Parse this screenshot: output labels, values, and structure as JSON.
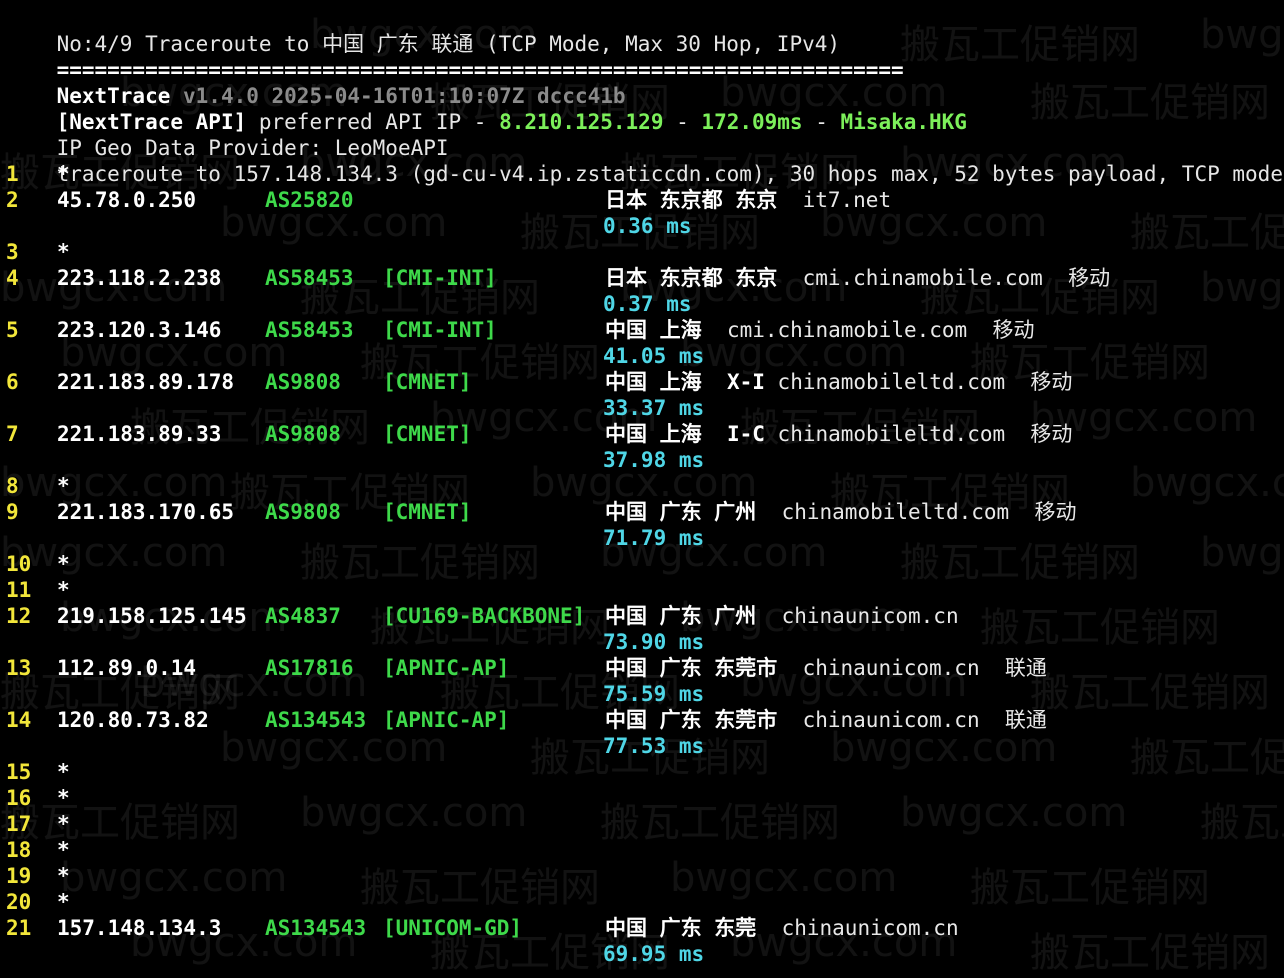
{
  "header": {
    "title_line": "No:4/9 Traceroute to 中国 广东 联通 (TCP Mode, Max 30 Hop, IPv4)",
    "separator": "===================================================================",
    "app_name": "NextTrace",
    "version_info": " v1.4.0 2025-04-16T01:10:07Z dccc41b",
    "api_label": "[NextTrace API]",
    "api_text": " preferred API IP - ",
    "api_ip": "8.210.125.129",
    "api_dash1": " - ",
    "api_latency": "172.09ms",
    "api_dash2": " - ",
    "api_node": "Misaka.HKG",
    "geo_provider": "IP Geo Data Provider: LeoMoeAPI",
    "traceroute_line": "traceroute to 157.148.134.3 (gd-cu-v4.ip.zstaticcdn.com), 30 hops max, 52 bytes payload, TCP mode"
  },
  "hops": [
    {
      "num": "1",
      "star": "*"
    },
    {
      "num": "2",
      "ip": "45.78.0.250",
      "asn": "AS25820",
      "tag": "",
      "geo": "日本 东京都 东京",
      "code": "",
      "host": "it7.net",
      "isp": "",
      "rtt": "0.36 ms"
    },
    {
      "num": "3",
      "star": "*"
    },
    {
      "num": "4",
      "ip": "223.118.2.238",
      "asn": "AS58453",
      "tag": "[CMI-INT]",
      "geo": "日本 东京都 东京",
      "code": "",
      "host": "cmi.chinamobile.com",
      "isp": "移动",
      "rtt": "0.37 ms"
    },
    {
      "num": "5",
      "ip": "223.120.3.146",
      "asn": "AS58453",
      "tag": "[CMI-INT]",
      "geo": "中国 上海",
      "code": "",
      "host": "cmi.chinamobile.com",
      "isp": "移动",
      "rtt": "41.05 ms"
    },
    {
      "num": "6",
      "ip": "221.183.89.178",
      "asn": "AS9808",
      "tag": "[CMNET]",
      "geo": "中国 上海",
      "code": "X-I",
      "host": "chinamobileltd.com",
      "isp": "移动",
      "rtt": "33.37 ms"
    },
    {
      "num": "7",
      "ip": "221.183.89.33",
      "asn": "AS9808",
      "tag": "[CMNET]",
      "geo": "中国 上海",
      "code": "I-C",
      "host": "chinamobileltd.com",
      "isp": "移动",
      "rtt": "37.98 ms"
    },
    {
      "num": "8",
      "star": "*"
    },
    {
      "num": "9",
      "ip": "221.183.170.65",
      "asn": "AS9808",
      "tag": "[CMNET]",
      "geo": "中国 广东 广州",
      "code": "",
      "host": "chinamobileltd.com",
      "isp": "移动",
      "rtt": "71.79 ms"
    },
    {
      "num": "10",
      "star": "*"
    },
    {
      "num": "11",
      "star": "*"
    },
    {
      "num": "12",
      "ip": "219.158.125.145",
      "asn": "AS4837",
      "tag": "[CU169-BACKBONE]",
      "geo": "中国 广东 广州",
      "code": "",
      "host": "chinaunicom.cn",
      "isp": "",
      "rtt": "73.90 ms"
    },
    {
      "num": "13",
      "ip": "112.89.0.14",
      "asn": "AS17816",
      "tag": "[APNIC-AP]",
      "geo": "中国 广东 东莞市",
      "code": "",
      "host": "chinaunicom.cn",
      "isp": "联通",
      "rtt": "75.59 ms"
    },
    {
      "num": "14",
      "ip": "120.80.73.82",
      "asn": "AS134543",
      "tag": "[APNIC-AP]",
      "geo": "中国 广东 东莞市",
      "code": "",
      "host": "chinaunicom.cn",
      "isp": "联通",
      "rtt": "77.53 ms"
    },
    {
      "num": "15",
      "star": "*"
    },
    {
      "num": "16",
      "star": "*"
    },
    {
      "num": "17",
      "star": "*"
    },
    {
      "num": "18",
      "star": "*"
    },
    {
      "num": "19",
      "star": "*"
    },
    {
      "num": "20",
      "star": "*"
    },
    {
      "num": "21",
      "ip": "157.148.134.3",
      "asn": "AS134543",
      "tag": "[UNICOM-GD]",
      "geo": "中国 广东 东莞",
      "code": "",
      "host": "chinaunicom.cn",
      "isp": "",
      "rtt": "69.95 ms"
    }
  ],
  "watermark": {
    "domain": "bwgcx.com",
    "brand": "搬瓦工促销网"
  }
}
